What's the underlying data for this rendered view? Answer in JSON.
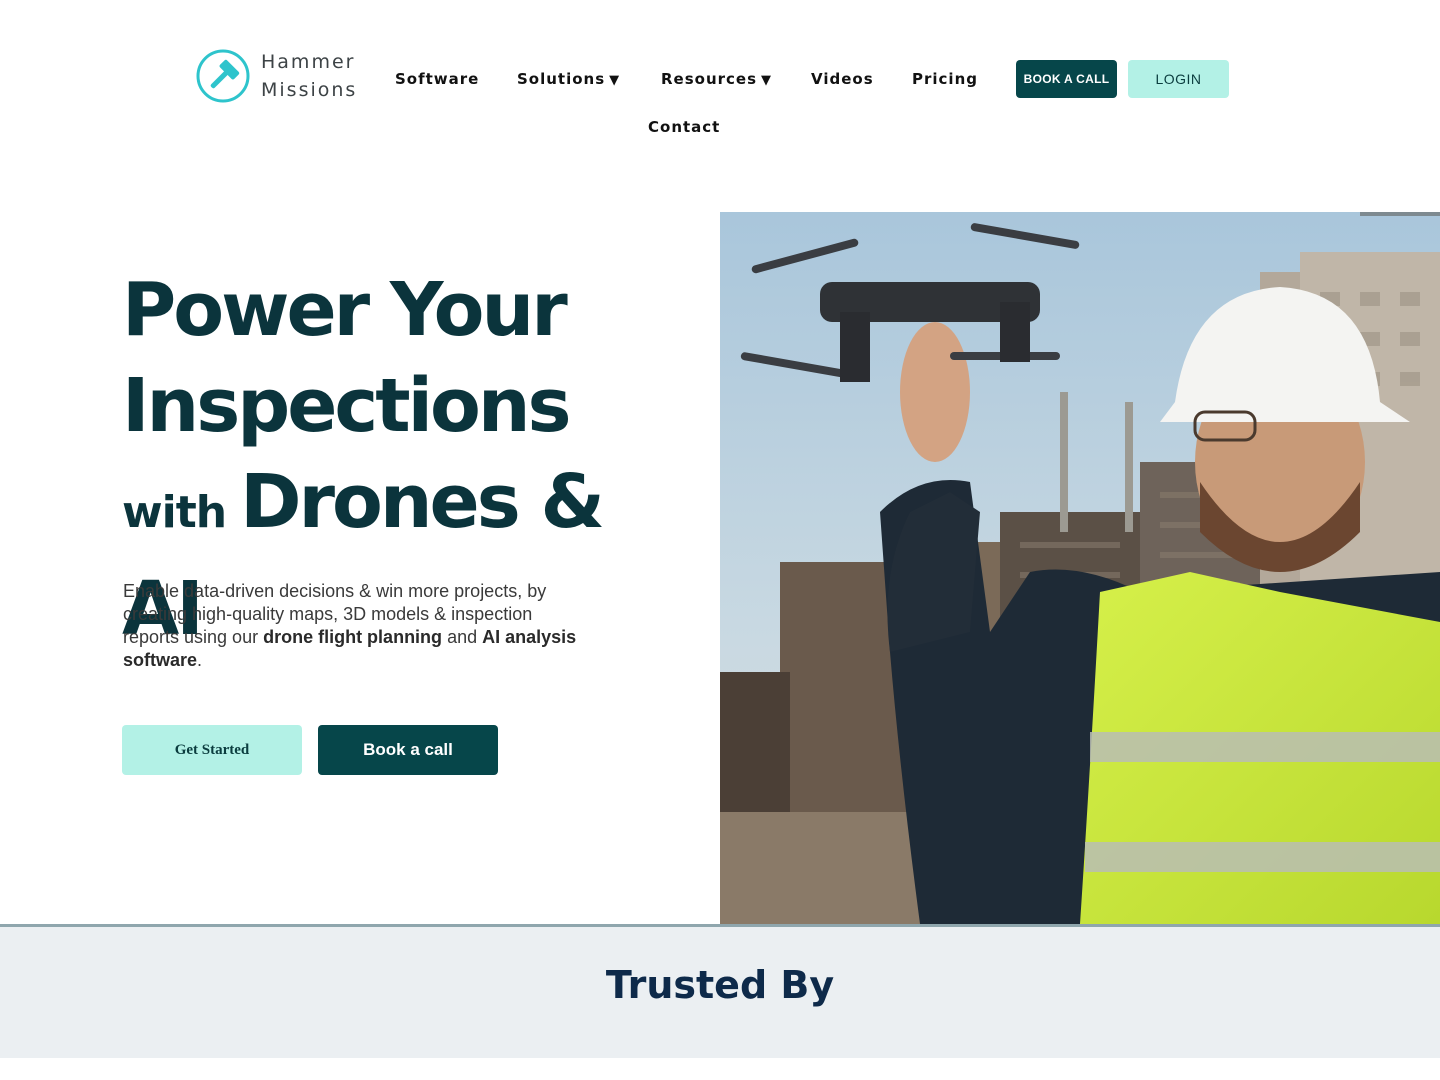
{
  "brand": {
    "name_line1": "Hammer",
    "name_line2": "Missions",
    "accent": "#2ec4cc"
  },
  "nav": {
    "items": [
      {
        "label": "Software",
        "caret": ""
      },
      {
        "label": "Solutions",
        "caret": "▼"
      },
      {
        "label": "Resources",
        "caret": "▼"
      },
      {
        "label": "Videos",
        "caret": ""
      },
      {
        "label": "Pricing",
        "caret": ""
      },
      {
        "label": "Contact",
        "caret": ""
      }
    ],
    "book_call": "BOOK A CALL",
    "login": "LOGIN"
  },
  "hero": {
    "line1": "Power Your",
    "line2": "Inspections",
    "line3_small": "with",
    "line3_big": "Drones & AI",
    "desc_part1": "Enable data-driven decisions & win more projects, by creating high-quality maps, 3D models & inspection reports using our ",
    "desc_bold1": "drone flight planning",
    "desc_part2": " and ",
    "desc_bold2": "AI analysis software",
    "desc_part3": ".",
    "cta_primary": "Get Started",
    "cta_secondary": "Book a call",
    "image_icon": "drone-inspector-photo"
  },
  "trusted": {
    "title": "Trusted By"
  },
  "colors": {
    "primary_dark": "#06464a",
    "mint": "#b3f1e6",
    "heading": "#0b343c",
    "trusted_bg": "#ebeff2"
  }
}
